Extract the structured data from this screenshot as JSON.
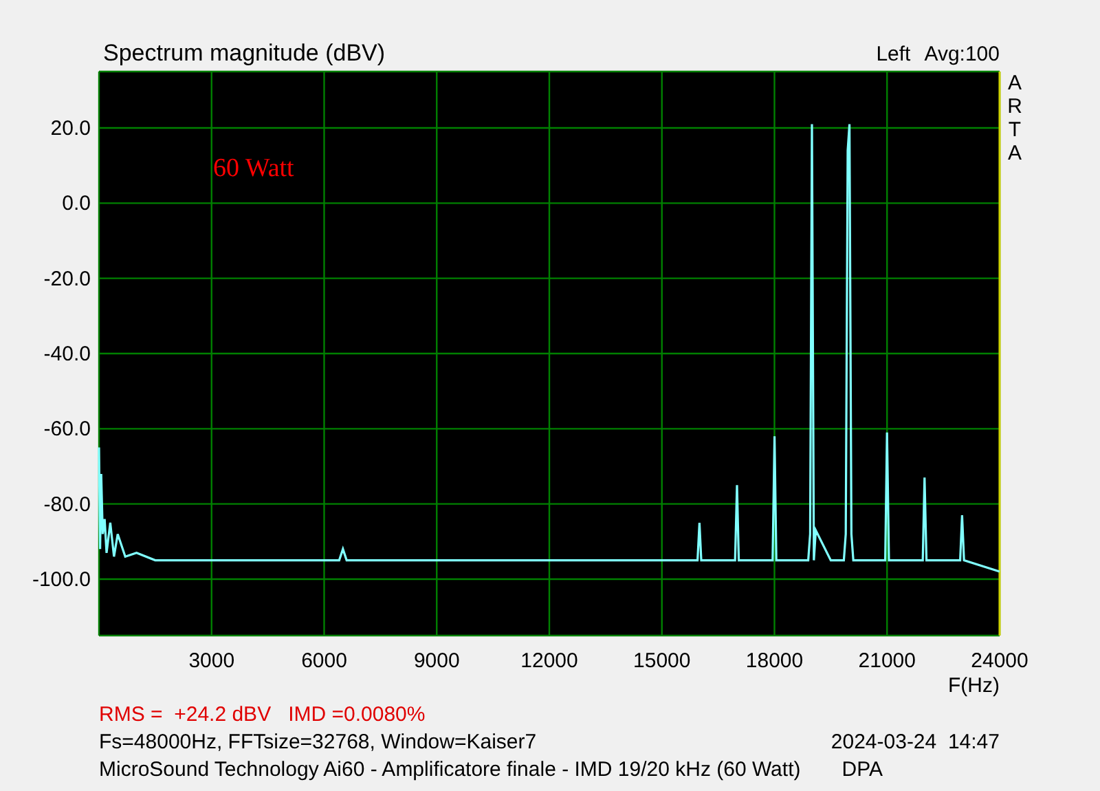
{
  "header": {
    "channel": "Left",
    "averaging": "Avg:100"
  },
  "side_label": "ARTA",
  "chart_data": {
    "type": "line",
    "title": "Spectrum magnitude (dBV)",
    "xlabel": "F(Hz)",
    "xlim": [
      0,
      24000
    ],
    "ylim": [
      -115,
      35
    ],
    "xticks": [
      3000,
      6000,
      9000,
      12000,
      15000,
      18000,
      21000,
      24000
    ],
    "yticks": [
      {
        "value": 20,
        "label": "20.0"
      },
      {
        "value": 0,
        "label": "0.0"
      },
      {
        "value": -20,
        "label": "-20.0"
      },
      {
        "value": -40,
        "label": "-40.0"
      },
      {
        "value": -60,
        "label": "-60.0"
      },
      {
        "value": -80,
        "label": "-80.0"
      },
      {
        "value": -100,
        "label": "-100.0"
      }
    ],
    "x": [
      0,
      30,
      60,
      100,
      150,
      200,
      300,
      400,
      500,
      700,
      1000,
      1500,
      2000,
      3000,
      6400,
      6500,
      6600,
      9000,
      12000,
      15000,
      15950,
      16000,
      16050,
      16950,
      17000,
      17050,
      17950,
      18000,
      18050,
      18900,
      18950,
      19000,
      19050,
      19100,
      19500,
      19850,
      19900,
      19950,
      20000,
      20050,
      20100,
      20950,
      21000,
      21050,
      21950,
      22000,
      22050,
      22950,
      23000,
      23050,
      24000
    ],
    "series": [
      {
        "color": "#80ffff",
        "values": [
          -65,
          -92,
          -72,
          -88,
          -84,
          -93,
          -85,
          -94,
          -88,
          -94,
          -93,
          -95,
          -95,
          -95,
          -95,
          -92,
          -95,
          -95,
          -95,
          -95,
          -95,
          -85,
          -95,
          -95,
          -75,
          -95,
          -95,
          -62,
          -95,
          -95,
          -88,
          21,
          -95,
          -87,
          -95,
          -95,
          -88,
          14,
          21,
          -88,
          -95,
          -95,
          -61,
          -95,
          -95,
          -73,
          -95,
          -95,
          -83,
          -95,
          -98
        ]
      }
    ],
    "grid": true,
    "annotations": [
      "60 Watt"
    ]
  },
  "measurement": "RMS =  +24.2 dBV   IMD =0.0080%",
  "settings": "Fs=48000Hz, FFTsize=32768, Window=Kaiser7",
  "timestamp": "2024-03-24  14:47",
  "description": "MicroSound Technology Ai60 - Amplificatore finale - IMD 19/20 kHz (60 Watt)",
  "tag": "DPA"
}
